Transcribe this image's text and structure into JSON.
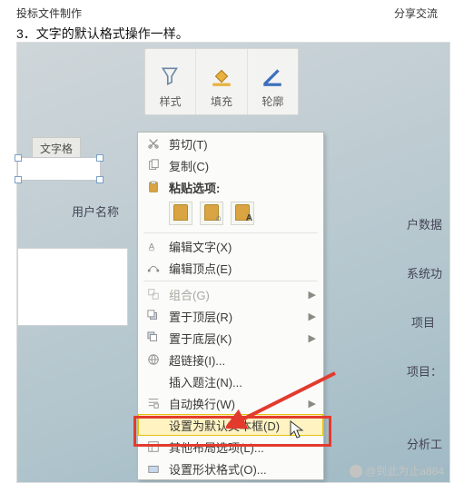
{
  "header": {
    "left": "投标文件制作",
    "right": "分享交流"
  },
  "caption": "3．文字的默认格式操作一样。",
  "ribbon": {
    "items": [
      {
        "label": "样式"
      },
      {
        "label": "填充"
      },
      {
        "label": "轮廓"
      }
    ]
  },
  "canvas": {
    "textbox_label": "文字格",
    "user_label": "用户名称",
    "right_cells": [
      "户数据",
      "系统功",
      "项目",
      "项目：",
      "分析工"
    ]
  },
  "menu": {
    "cut": "剪切(T)",
    "copy": "复制(C)",
    "paste_header": "粘贴选项:",
    "edit_text": "编辑文字(X)",
    "edit_points": "编辑顶点(E)",
    "group": "组合(G)",
    "bring_front": "置于顶层(R)",
    "send_back": "置于底层(K)",
    "hyperlink": "超链接(I)...",
    "insert_caption": "插入题注(N)...",
    "wrap_text": "自动换行(W)",
    "set_default_textbox": "设置为默认文本框(D)",
    "more_layout": "其他布局选项(L)...",
    "format_shape": "设置形状格式(O)..."
  },
  "watermark": "@到此为止a884"
}
